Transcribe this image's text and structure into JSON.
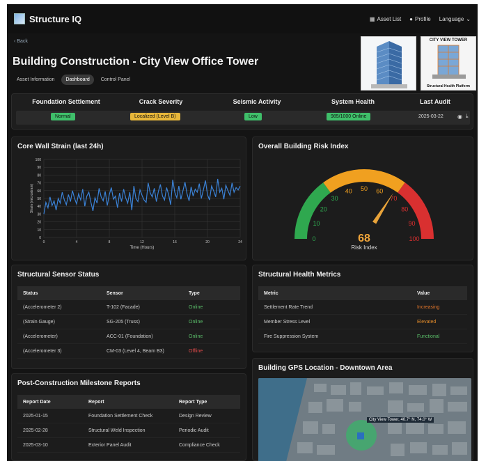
{
  "app": {
    "name": "Structure IQ",
    "nav": {
      "asset_list": "Asset List",
      "profile": "Profile",
      "language": "Language"
    }
  },
  "back_label": "Back",
  "page_title": "Building Construction - City View Office Tower",
  "tabs": [
    "Asset Information",
    "Dashboard",
    "Control Panel"
  ],
  "thumb2": {
    "caption": "CITY VIEW TOWER",
    "subcaption": "Structural Health Platform"
  },
  "status": {
    "headers": [
      "Foundation Settlement",
      "Crack Severity",
      "Seismic Activity",
      "System Health",
      "Last Audit"
    ],
    "values": [
      "Normal",
      "Localized (Level B)",
      "Low",
      "985/1000 Online",
      "2025-03-22"
    ]
  },
  "strain_panel": {
    "title": "Core Wall Strain (last 24h)"
  },
  "risk_panel": {
    "title": "Overall Building Risk Index",
    "value": "68",
    "label": "Risk Index"
  },
  "sensor_panel": {
    "title": "Structural Sensor Status",
    "headers": [
      "Status",
      "Sensor",
      "Type"
    ],
    "rows": [
      [
        "(Accelerometer 2)",
        "T-102 (Facade)",
        "Online"
      ],
      [
        "(Strain Gauge)",
        "SG-205 (Truss)",
        "Online"
      ],
      [
        "(Accelerometer)",
        "ACC-01 (Foundation)",
        "Online"
      ],
      [
        "(Accelerometer 3)",
        "CM-03 (Level 4, Beam B3)",
        "Offline"
      ]
    ]
  },
  "metrics_panel": {
    "title": "Structural Health Metrics",
    "headers": [
      "Metric",
      "Value"
    ],
    "rows": [
      [
        "Settlement Rate Trend",
        "Increasing"
      ],
      [
        "Member Stress Level",
        "Elevated"
      ],
      [
        "Fire Suppression System",
        "Functional"
      ]
    ]
  },
  "reports_panel": {
    "title": "Post-Construction Milestone Reports",
    "headers": [
      "Report Date",
      "Report",
      "Report Type"
    ],
    "rows": [
      [
        "2025-01-15",
        "Foundation Settlement Check",
        "Design Review"
      ],
      [
        "2025-02-28",
        "Structural Weld Inspection",
        "Periodic Audit"
      ],
      [
        "2025-03-10",
        "Exterior Panel Audit",
        "Compliance Check"
      ]
    ]
  },
  "gps_panel": {
    "title": "Building GPS Location - Downtown Area",
    "marker_label": "City View Tower, 40.7° N, 74.0° W"
  },
  "chart_data": [
    {
      "type": "line",
      "xlabel": "Time (Hours)",
      "ylabel": "Strain (microstrain)",
      "xlim": [
        0,
        24
      ],
      "ylim": [
        0,
        100
      ],
      "xticks": [
        0,
        4,
        8,
        12,
        16,
        20,
        24
      ],
      "yticks": [
        0,
        10,
        20,
        30,
        40,
        50,
        60,
        70,
        80,
        90,
        100
      ],
      "grid": true,
      "color": "#3b82d6",
      "x": [
        0,
        0.25,
        0.5,
        0.75,
        1,
        1.25,
        1.5,
        1.75,
        2,
        2.25,
        2.5,
        2.75,
        3,
        3.25,
        3.5,
        3.75,
        4,
        4.25,
        4.5,
        4.75,
        5,
        5.25,
        5.5,
        5.75,
        6,
        6.25,
        6.5,
        6.75,
        7,
        7.25,
        7.5,
        7.75,
        8,
        8.25,
        8.5,
        8.75,
        9,
        9.25,
        9.5,
        9.75,
        10,
        10.25,
        10.5,
        10.75,
        11,
        11.25,
        11.5,
        11.75,
        12,
        12.25,
        12.5,
        12.75,
        13,
        13.25,
        13.5,
        13.75,
        14,
        14.25,
        14.5,
        14.75,
        15,
        15.25,
        15.5,
        15.75,
        16,
        16.25,
        16.5,
        16.75,
        17,
        17.25,
        17.5,
        17.75,
        18,
        18.25,
        18.5,
        18.75,
        19,
        19.25,
        19.5,
        19.75,
        20,
        20.25,
        20.5,
        20.75,
        21,
        21.25,
        21.5,
        21.75,
        22,
        22.25,
        22.5,
        22.75,
        23,
        23.25,
        23.5,
        23.75,
        24
      ],
      "y": [
        30,
        45,
        38,
        52,
        41,
        47,
        35,
        50,
        44,
        58,
        48,
        42,
        55,
        46,
        60,
        50,
        43,
        56,
        48,
        62,
        40,
        53,
        58,
        45,
        34,
        51,
        44,
        63,
        52,
        47,
        59,
        41,
        55,
        64,
        49,
        53,
        38,
        57,
        46,
        62,
        51,
        44,
        58,
        35,
        66,
        50,
        46,
        61,
        54,
        48,
        45,
        70,
        57,
        52,
        63,
        46,
        59,
        68,
        53,
        48,
        64,
        55,
        42,
        74,
        58,
        51,
        66,
        49,
        60,
        71,
        56,
        47,
        65,
        53,
        62,
        58,
        69,
        50,
        61,
        73,
        55,
        48,
        66,
        60,
        52,
        75,
        58,
        63,
        49,
        67,
        60,
        54,
        70,
        58,
        64,
        61,
        66
      ]
    },
    {
      "type": "gauge",
      "value": 68,
      "min": 0,
      "max": 100,
      "ticks": [
        0,
        10,
        20,
        30,
        40,
        50,
        60,
        70,
        80,
        90,
        100
      ],
      "bands": [
        {
          "from": 0,
          "to": 30,
          "color": "#2fa84f"
        },
        {
          "from": 30,
          "to": 70,
          "color": "#f0a020"
        },
        {
          "from": 70,
          "to": 100,
          "color": "#d93030"
        }
      ]
    }
  ]
}
